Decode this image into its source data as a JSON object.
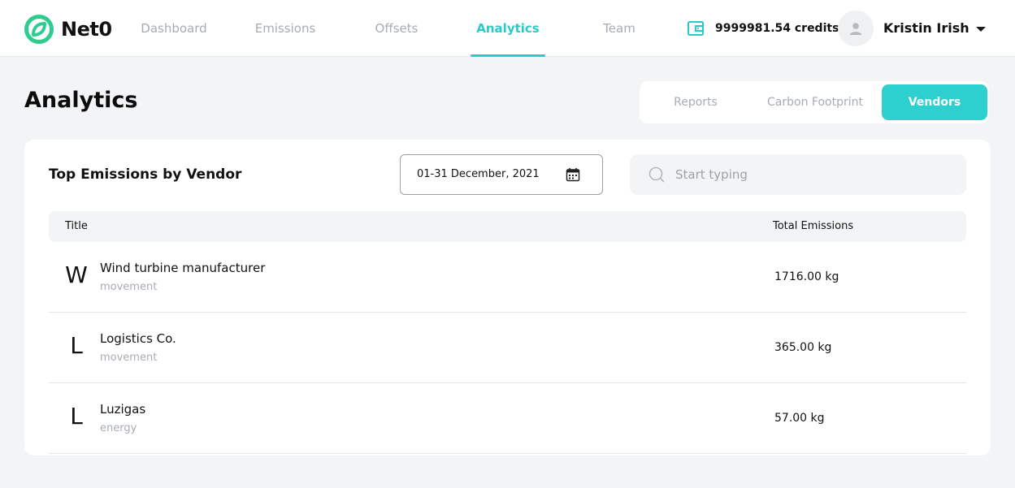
{
  "brand": {
    "name": "Net0",
    "accent": "#2cc9c9",
    "logo_color": "#2ecc8f"
  },
  "nav": {
    "tabs": [
      {
        "label": "Dashboard",
        "active": false
      },
      {
        "label": "Emissions",
        "active": false
      },
      {
        "label": "Offsets",
        "active": false
      },
      {
        "label": "Analytics",
        "active": true
      },
      {
        "label": "Team",
        "active": false
      }
    ]
  },
  "account": {
    "credits": "9999981.54 credits",
    "credits_icon": "wallet-icon",
    "user_name": "Kristin Irish",
    "avatar_icon": "user-icon",
    "menu_icon": "caret-down-icon"
  },
  "page": {
    "title": "Analytics"
  },
  "segments": [
    {
      "label": "Reports",
      "active": false
    },
    {
      "label": "Carbon Footprint",
      "active": false
    },
    {
      "label": "Vendors",
      "active": true
    }
  ],
  "card": {
    "title": "Top Emissions by Vendor",
    "date_range": "01-31 December, 2021",
    "date_icon": "calendar-icon",
    "search": {
      "placeholder": "Start typing",
      "value": "",
      "icon": "search-icon"
    },
    "columns": {
      "title": "Title",
      "total": "Total Emissions"
    },
    "rows": [
      {
        "initial": "W",
        "title": "Wind turbine manufacturer",
        "category": "movement",
        "total": "1716.00 kg"
      },
      {
        "initial": "L",
        "title": "Logistics Co.",
        "category": "movement",
        "total": "365.00 kg"
      },
      {
        "initial": "L",
        "title": "Luzigas",
        "category": "energy",
        "total": "57.00 kg"
      }
    ]
  }
}
